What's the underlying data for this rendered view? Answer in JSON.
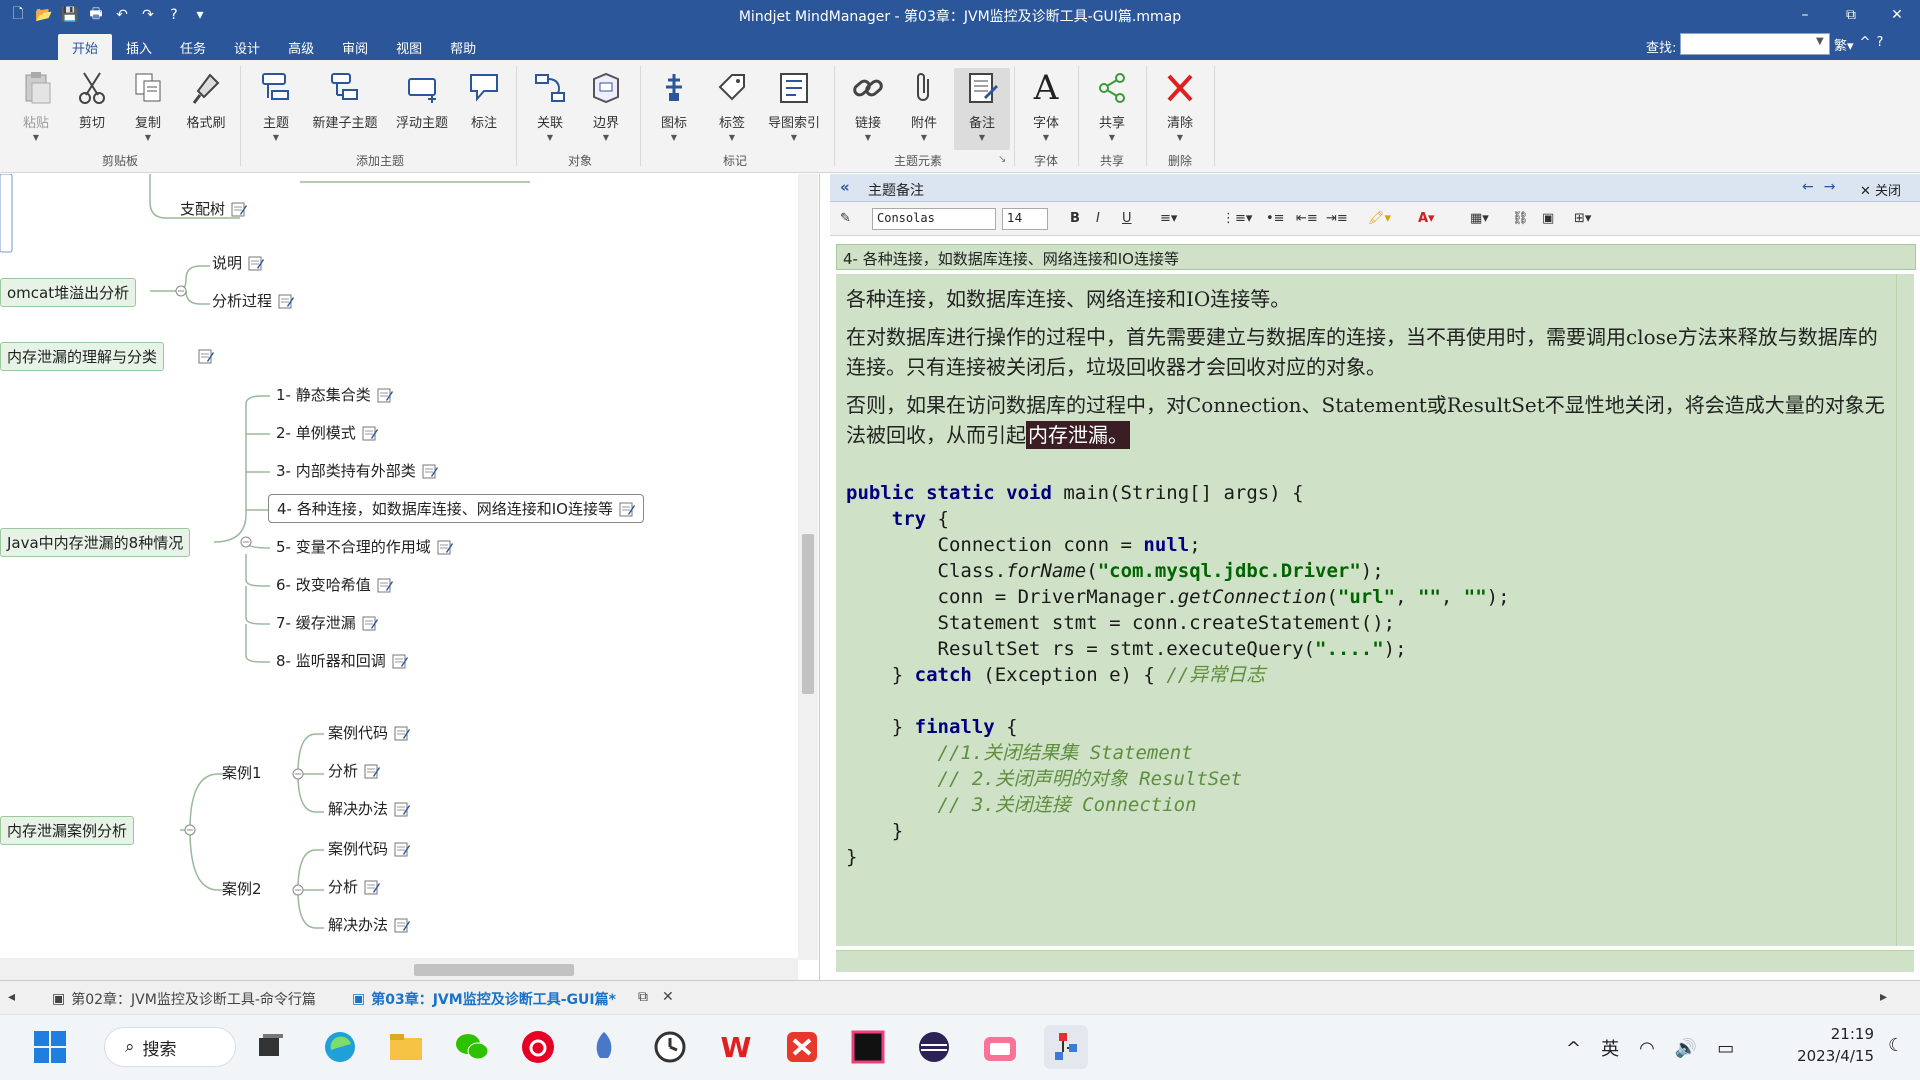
{
  "window": {
    "title": "Mindjet MindManager - 第03章：JVM监控及诊断工具-GUI篇.mmap",
    "controls": [
      "–",
      "⧉",
      "✕"
    ]
  },
  "ribbon_tabs": [
    "开始",
    "插入",
    "任务",
    "设计",
    "高级",
    "审阅",
    "视图",
    "帮助"
  ],
  "find": {
    "label": "查找:",
    "value": ""
  },
  "ribbon": {
    "buttons": {
      "paste": "粘贴",
      "cut": "剪切",
      "copy": "复制",
      "format_painter": "格式刷",
      "topic": "主题",
      "subtopic": "新建子主题",
      "floating_topic": "浮动主题",
      "callout": "标注",
      "relationship": "关联",
      "boundary": "边界",
      "icon": "图标",
      "tag": "标签",
      "map_index": "导图索引",
      "link": "链接",
      "attachment": "附件",
      "notes": "备注",
      "font": "字体",
      "share": "共享",
      "clear": "清除"
    },
    "groups": {
      "clipboard": "剪贴板",
      "add_topic": "添加主题",
      "object": "对象",
      "markers": "标记",
      "topic_elements": "主题元素",
      "font": "字体",
      "share": "共享",
      "delete": "删除"
    }
  },
  "map": {
    "nodes": {
      "support_tree": "支配树",
      "tomcat": "omcat堆溢出分析",
      "explain": "说明",
      "analysis_process": "分析过程",
      "leak_understanding": "内存泄漏的理解与分类",
      "java_leak_8": "Java中内存泄漏的8种情况",
      "c1": "1- 静态集合类",
      "c2": "2- 单例模式",
      "c3": "3- 内部类持有外部类",
      "c4": "4- 各种连接，如数据库连接、网络连接和IO连接等",
      "c5": "5- 变量不合理的作用域",
      "c6": "6- 改变哈希值",
      "c7": "7- 缓存泄漏",
      "c8": "8- 监听器和回调",
      "case_analysis": "内存泄漏案例分析",
      "case1": "案例1",
      "case1_code": "案例代码",
      "case1_analysis": "分析",
      "case1_solution": "解决办法",
      "case2": "案例2",
      "case2_code": "案例代码",
      "case2_analysis": "分析",
      "case2_solution": "解决办法"
    }
  },
  "notes": {
    "header_title": "主题备注",
    "close_label": "关闭",
    "font": "Consolas",
    "size": "14",
    "topic_line": "4- 各种连接，如数据库连接、网络连接和IO连接等",
    "p1": "各种连接，如数据库连接、网络连接和IO连接等。",
    "p2": "在对数据库进行操作的过程中，首先需要建立与数据库的连接，当不再使用时，需要调用close方法来释放与数据库的连接。只有连接被关闭后，垃圾回收器才会回收对应的对象。",
    "p3_pre": "否则，如果在访问数据库的过程中，对Connection、Statement或ResultSet不显性地关闭，将会造成大量的对象无法被回收，从而引起",
    "p3_hl": "内存泄漏。",
    "code": {
      "l1a": "public static void ",
      "l1b": "main(String[] args) {",
      "l2a": "    try",
      "l2b": " {",
      "l3a": "        Connection conn = ",
      "l3b": "null",
      "l3c": ";",
      "l4a": "        Class.",
      "l4b": "forName",
      "l4c": "(",
      "l4d": "\"com.mysql.jdbc.Driver\"",
      "l4e": ");",
      "l5a": "        conn = DriverManager.",
      "l5b": "getConnection",
      "l5c": "(",
      "l5d": "\"url\"",
      "l5e": ", ",
      "l5f": "\"\"",
      "l5g": ", ",
      "l5h": "\"\"",
      "l5i": ");",
      "l6": "        Statement stmt = conn.createStatement();",
      "l7a": "        ResultSet rs = stmt.executeQuery(",
      "l7b": "\"....\"",
      "l7c": ");",
      "l8a": "    } ",
      "l8b": "catch",
      "l8c": " (Exception e) { ",
      "l8d": "//异常日志",
      "l9a": "    } ",
      "l9b": "finally",
      "l9c": " {",
      "l10": "        //1.关闭结果集 Statement",
      "l11": "        // 2.关闭声明的对象 ResultSet",
      "l12": "        // 3.关闭连接 Connection",
      "l13": "    }",
      "l14": "}"
    }
  },
  "doc_tabs": {
    "tab1": "第02章：JVM监控及诊断工具-命令行篇",
    "tab2": "第03章：JVM监控及诊断工具-GUI篇*"
  },
  "taskbar": {
    "search": "搜索",
    "ime": "英",
    "time": "21:19",
    "date": "2023/4/15"
  },
  "colors": {
    "title_bar": "#2b579a",
    "notes_bg": "#cfe2c7",
    "highlight": "#3a1e24",
    "keyword": "#000080",
    "string": "#006400",
    "comment": "#5e8e3e"
  }
}
